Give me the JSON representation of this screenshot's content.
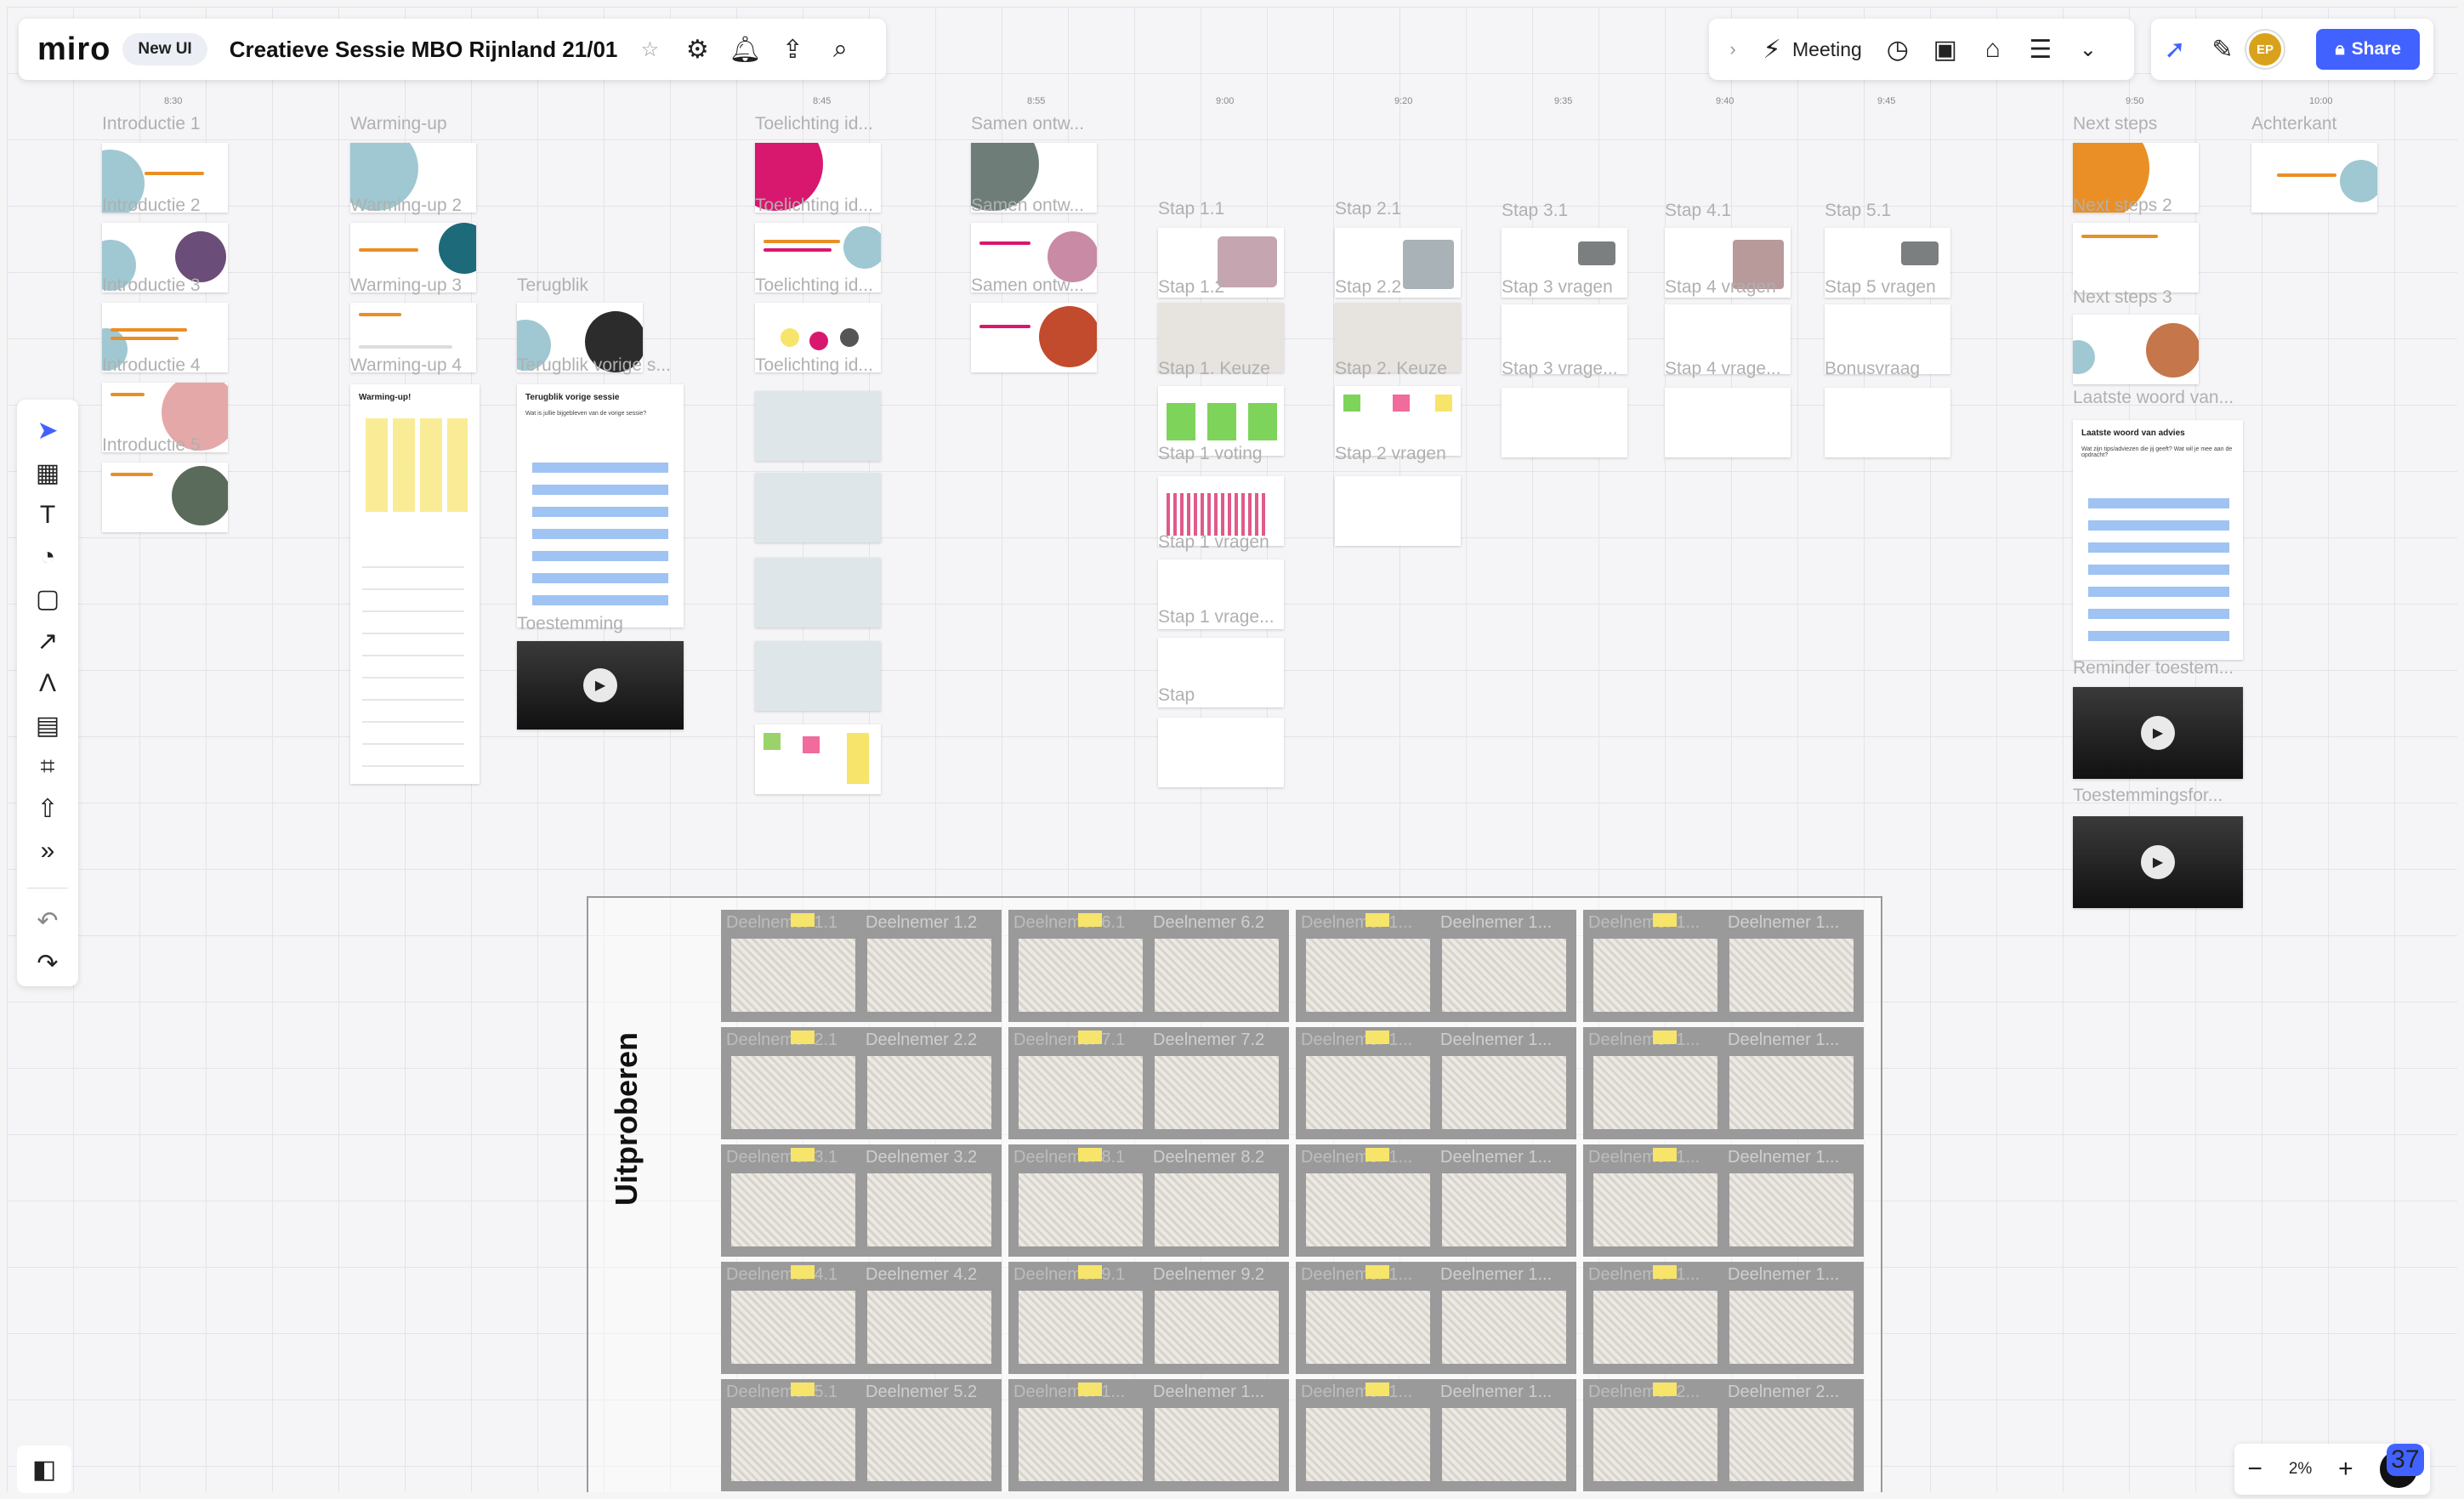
{
  "app": {
    "logo": "miro",
    "badge": "New UI"
  },
  "board": {
    "title": "Creatieve Sessie MBO Rijnland 21/01"
  },
  "toolbar_right": {
    "meeting_label": "Meeting",
    "share_label": "Share",
    "avatar_initials": "EP"
  },
  "zoom": {
    "minus": "−",
    "value": "2%",
    "plus": "+",
    "help": "?",
    "help_badge": "37"
  },
  "time_labels": [
    "8:30",
    "8:45",
    "8:55",
    "9:00",
    "9:20",
    "9:35",
    "9:40",
    "9:45",
    "9:50",
    "10:00"
  ],
  "columns": {
    "introductie": [
      "Introductie 1",
      "Introductie 2",
      "Introductie 3",
      "Introductie 4",
      "Introductie 5"
    ],
    "warmingup": [
      "Warming-up",
      "Warming-up 2",
      "Warming-up 3",
      "Warming-up 4"
    ],
    "terugblik": [
      "Terugblik",
      "Terugblik vorige s...",
      "Toestemming"
    ],
    "toelichting": [
      "Toelichting id...",
      "Toelichting id...",
      "Toelichting id...",
      "Toelichting id..."
    ],
    "samen": [
      "Samen ontw...",
      "Samen ontw...",
      "Samen ontw..."
    ],
    "stap1": [
      "Stap 1.1",
      "Stap 1.2",
      "Stap 1. Keuze",
      "Stap 1 voting",
      "Stap 1 vragen",
      "Stap 1 vrage...",
      "Stap"
    ],
    "stap2": [
      "Stap 2.1",
      "Stap 2.2",
      "Stap 2. Keuze",
      "Stap 2 vragen"
    ],
    "stap3": [
      "Stap 3.1",
      "Stap 3 vragen",
      "Stap 3 vrage..."
    ],
    "stap4": [
      "Stap 4.1",
      "Stap 4 vragen",
      "Stap 4 vrage..."
    ],
    "stap5": [
      "Stap 5.1",
      "Stap 5 vragen",
      "Bonusvraag"
    ],
    "next": [
      "Next steps",
      "Next steps 2",
      "Next steps 3",
      "Laatste woord van...",
      "Reminder toestem...",
      "Toestemmingsfor..."
    ],
    "achterkant": [
      "Achterkant"
    ]
  },
  "tall_cards": {
    "warmingup_title": "Warming-up!",
    "terugblik_title": "Terugblik vorige sessie",
    "terugblik_sub": "Wat is jullie bijgebleven van de vorige sessie?",
    "laatste_title": "Laatste woord van advies",
    "laatste_sub": "Wat zijn tips/adviezen die jij geeft? Wat wil je mee aan de opdracht?"
  },
  "uitproberen": {
    "title": "Uitproberen",
    "rows": [
      [
        "Deelnemer 1.1",
        "Deelnemer 1.2",
        "Deelnemer 6.1",
        "Deelnemer 6.2",
        "Deelnemer 1...",
        "Deelnemer 1...",
        "Deelnemer 1...",
        "Deelnemer 1..."
      ],
      [
        "Deelnemer 2.1",
        "Deelnemer 2.2",
        "Deelnemer 7.1",
        "Deelnemer 7.2",
        "Deelnemer 1...",
        "Deelnemer 1...",
        "Deelnemer 1...",
        "Deelnemer 1..."
      ],
      [
        "Deelnemer 3.1",
        "Deelnemer 3.2",
        "Deelnemer 8.1",
        "Deelnemer 8.2",
        "Deelnemer 1...",
        "Deelnemer 1...",
        "Deelnemer 1...",
        "Deelnemer 1..."
      ],
      [
        "Deelnemer 4.1",
        "Deelnemer 4.2",
        "Deelnemer 9.1",
        "Deelnemer 9.2",
        "Deelnemer 1...",
        "Deelnemer 1...",
        "Deelnemer 1...",
        "Deelnemer 1..."
      ],
      [
        "Deelnemer 5.1",
        "Deelnemer 5.2",
        "Deelnemer 1...",
        "Deelnemer 1...",
        "Deelnemer 1...",
        "Deelnemer 1...",
        "Deelnemer 2...",
        "Deelnemer 2..."
      ]
    ]
  },
  "colors": {
    "accent": "#4262ff",
    "teal": "#9fc8d2",
    "magenta": "#d8176f",
    "orange": "#e98f25",
    "sticky": "#f7e46a"
  }
}
